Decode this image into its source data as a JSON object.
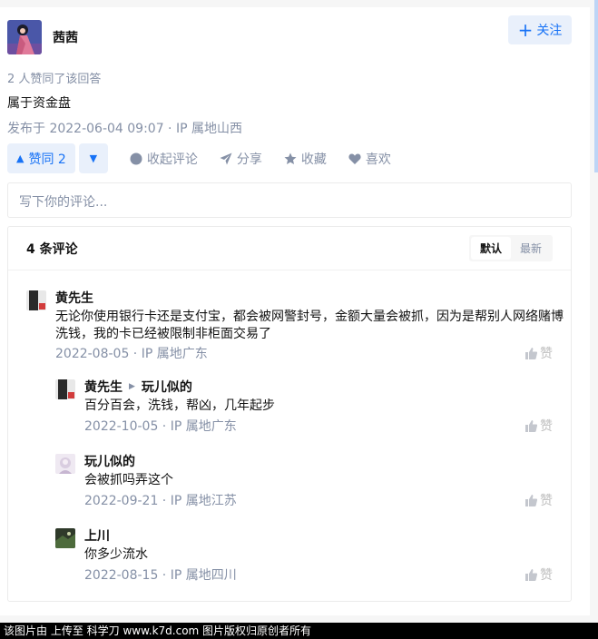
{
  "author": {
    "name": "茜茜"
  },
  "follow": {
    "label": "关注"
  },
  "voters_text": "2 人赞同了该回答",
  "answer_text": "属于资金盘",
  "meta_text": "发布于 2022-06-04 09:07 · IP 属地山西",
  "actions": {
    "vote_up": "赞同 2",
    "collapse_comments": "收起评论",
    "share": "分享",
    "favorite": "收藏",
    "like": "喜欢"
  },
  "comment_input": {
    "placeholder": "写下你的评论..."
  },
  "comments_header": {
    "count": "4 条评论",
    "sort_default": "默认",
    "sort_latest": "最新"
  },
  "comments": [
    {
      "author": "黄先生",
      "text": "无论你使用银行卡还是支付宝，都会被网警封号，金额大量会被抓，因为是帮别人网络赌博洗钱，我的卡已经被限制非柜面交易了",
      "meta": "2022-08-05 · IP 属地广东",
      "like": "赞"
    },
    {
      "author": "黄先生",
      "reply_to": "玩儿似的",
      "text": "百分百会，洗钱，帮凶，几年起步",
      "meta": "2022-10-05 · IP 属地广东",
      "like": "赞"
    },
    {
      "author": "玩儿似的",
      "text": "会被抓吗弄这个",
      "meta": "2022-09-21 · IP 属地江苏",
      "like": "赞"
    },
    {
      "author": "上川",
      "text": "你多少流水",
      "meta": "2022-08-15 · IP 属地四川",
      "like": "赞"
    }
  ],
  "footer_text": "该图片由  上传至  科学刀  www.k7d.com  图片版权归原创者所有",
  "colors": {
    "brand": "#1772f6",
    "muted": "#8590a6",
    "vote_bg": "#e9f0fb"
  }
}
